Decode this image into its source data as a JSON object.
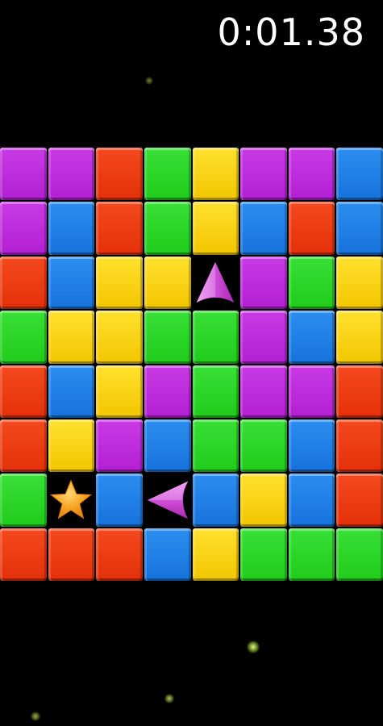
{
  "timer": "0:01.38",
  "board": {
    "rows": [
      [
        "purple",
        "purple",
        "red",
        "green",
        "yellow",
        "purple",
        "purple",
        "blue"
      ],
      [
        "purple",
        "blue",
        "red",
        "green",
        "yellow",
        "blue",
        "red",
        "blue"
      ],
      [
        "red",
        "blue",
        "yellow",
        "yellow",
        "arrow-up",
        "purple",
        "green",
        "yellow"
      ],
      [
        "green",
        "yellow",
        "yellow",
        "green",
        "green",
        "purple",
        "blue",
        "yellow"
      ],
      [
        "red",
        "blue",
        "yellow",
        "purple",
        "green",
        "purple",
        "purple",
        "red"
      ],
      [
        "red",
        "yellow",
        "purple",
        "blue",
        "green",
        "green",
        "blue",
        "red"
      ],
      [
        "green",
        "star",
        "blue",
        "arrow-left",
        "blue",
        "yellow",
        "blue",
        "red"
      ],
      [
        "red",
        "red",
        "red",
        "blue",
        "yellow",
        "green",
        "green",
        "green"
      ]
    ]
  },
  "colors": {
    "purple": "#c12bdc",
    "blue": "#2282e6",
    "red": "#ec3c14",
    "green": "#2ed62a",
    "yellow": "#fad818",
    "arrow": "#d050d8",
    "star": "#f7a21f",
    "background": "#000000"
  },
  "icons": {
    "arrow-up": "arrow-up-icon",
    "arrow-left": "arrow-left-icon",
    "star": "star-icon"
  }
}
